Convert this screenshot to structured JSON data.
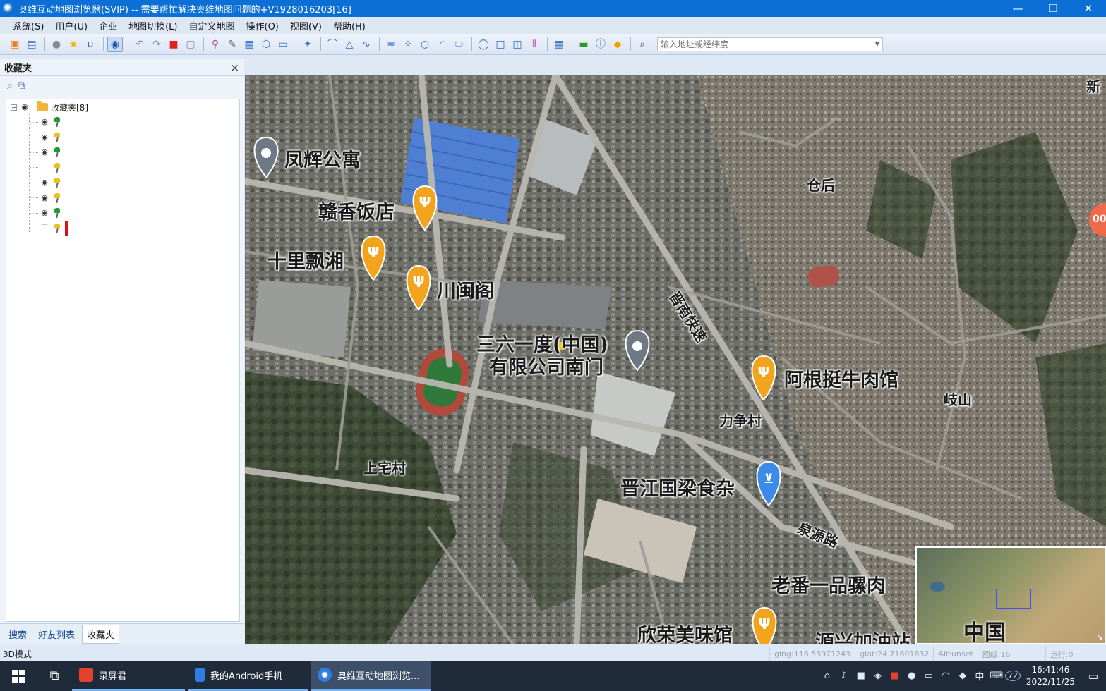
{
  "window": {
    "title": "奥维互动地图浏览器(SVIP) -- 需要帮忙解决奥维地图问题的+V1928016203[16]",
    "controls": {
      "minimize": "—",
      "restore": "❐",
      "close": "✕"
    }
  },
  "menu": [
    "系统(S)",
    "用户(U)",
    "企业",
    "地图切换(L)",
    "自定义地图",
    "操作(O)",
    "视图(V)",
    "帮助(H)"
  ],
  "toolbar": {
    "search_placeholder": "输入地址或经纬度"
  },
  "favorites_panel": {
    "title": "收藏夹",
    "close": "×",
    "root_label": "收藏夹[8]",
    "items": [
      {
        "visible": true,
        "pin_color": "green"
      },
      {
        "visible": true,
        "pin_color": "yellow"
      },
      {
        "visible": true,
        "pin_color": "green"
      },
      {
        "visible": false,
        "pin_color": "yellow"
      },
      {
        "visible": true,
        "pin_color": "yellow"
      },
      {
        "visible": true,
        "pin_color": "yellow"
      },
      {
        "visible": true,
        "pin_color": "green"
      },
      {
        "visible": false,
        "pin_color": "yellow",
        "selected": true
      }
    ],
    "tabs": [
      "搜索",
      "好友列表",
      "收藏夹"
    ],
    "active_tab": "收藏夹"
  },
  "map": {
    "labels": {
      "fenghui": "凤辉公寓",
      "ganxiang": "赣香饭店",
      "shilipiaoxiang": "十里飘湘",
      "chuanmin": "川闽阁",
      "sanliuyidu_1": "三六一度(中国)",
      "sanliuyidu_2": "有限公司南门",
      "cangmhou": "仓后",
      "jinnan": "晋南快速",
      "agen": "阿根挺牛肉馆",
      "qishan": "岐山",
      "lizheng": "力争村",
      "shangzhai": "上宅村",
      "guoliang": "晋江国梁食杂",
      "quanyuan": "泉源路",
      "laofan": "老番一品骡肉",
      "xinrong": "欣荣美味馆",
      "yuanxing": "源兴加油站",
      "xin_edge": "新",
      "edge_num": "00"
    },
    "minimap_label": "中国"
  },
  "statusbar": {
    "mode": "3D模式",
    "lng": "glng:118.53971243",
    "lat": "glat:24.71601832",
    "alt": "Alt:unset",
    "level": "图级:16",
    "running": "运行:0"
  },
  "taskbar": {
    "apps": [
      "录屏君",
      "我的Android手机",
      "奥维互动地图浏览..."
    ],
    "time": "16:41:46",
    "date": "2022/11/25",
    "ime": "中",
    "badge": "72"
  },
  "colors": {
    "titlebar": "#0b6fd6",
    "poi_orange": "#f1a41c",
    "poi_gray": "#6f7985",
    "poi_blue": "#3d8be8"
  }
}
